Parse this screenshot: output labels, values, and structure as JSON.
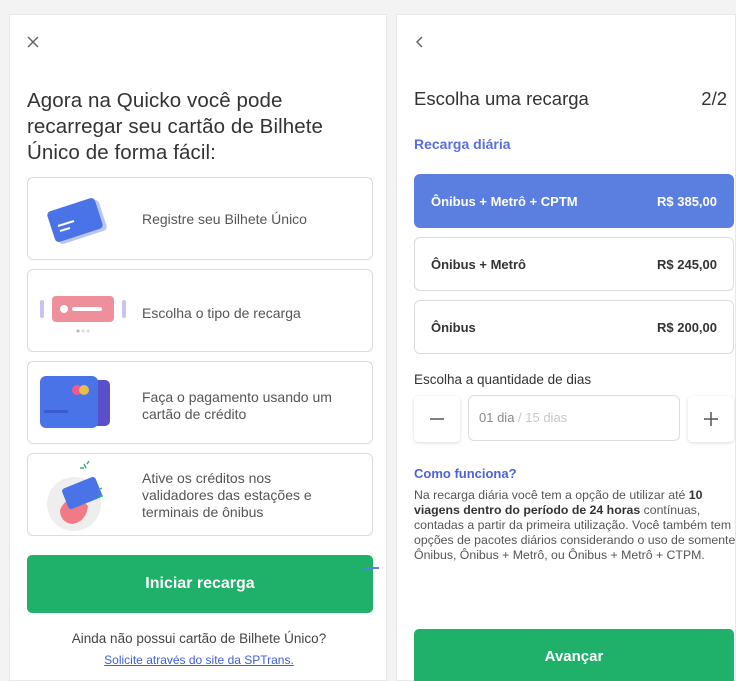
{
  "intro": {
    "headline": "Agora na Quicko você pode recarregar seu cartão de Bilhete Único de forma fácil:",
    "steps": [
      {
        "label": "Registre seu Bilhete Único",
        "icon": "card-icon"
      },
      {
        "label": "Escolha o tipo de recarga",
        "icon": "recharge-type-icon"
      },
      {
        "label": "Faça o pagamento usando um cartão de crédito",
        "icon": "credit-card-icon"
      },
      {
        "label": "Ative os créditos nos validadores das estações e terminais de ônibus",
        "icon": "tap-card-icon"
      }
    ],
    "start_button": "Iniciar recarga",
    "footer_question": "Ainda não possui cartão de Bilhete Único?",
    "footer_link": "Solicite através do site da SPTrans."
  },
  "recharge": {
    "title": "Escolha uma recarga",
    "step_indicator": "2/2",
    "section_title": "Recarga diária",
    "options": [
      {
        "name": "Ônibus + Metrô + CPTM",
        "price": "R$ 385,00",
        "selected": true
      },
      {
        "name": "Ônibus + Metrô",
        "price": "R$ 245,00",
        "selected": false
      },
      {
        "name": "Ônibus",
        "price": "R$ 200,00",
        "selected": false
      }
    ],
    "days_label": "Escolha a quantidade de dias",
    "days_value": "01 dia",
    "days_max": " / 15 dias",
    "how_title": "Como funciona?",
    "how_intro": "Na recarga diária você tem a opção de utilizar até",
    "how_bold": "10 viagens dentro do período de 24 horas",
    "how_rest": "contínuas, contadas a partir da primeira utilização. Você também tem opções de pacotes diários considerando o uso de somente Ônibus, Ônibus + Metrô, ou Ônibus + Metrô + CTPM.",
    "next_button": "Avançar"
  },
  "colors": {
    "green": "#1fb06a",
    "blue": "#5b7fe0",
    "link": "#3e5fd8"
  }
}
